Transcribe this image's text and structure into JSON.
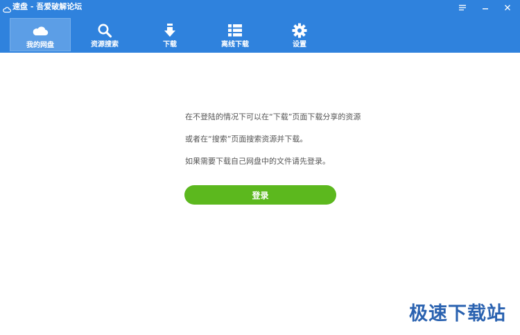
{
  "window": {
    "title": "速盘 - 吾爱破解论坛",
    "icons": {
      "logo": "cloud-icon",
      "menu": "menu-icon",
      "minimize": "minimize-icon",
      "close": "close-icon"
    }
  },
  "toolbar": {
    "items": [
      {
        "label": "我的网盘",
        "icon": "cloud-icon",
        "active": true
      },
      {
        "label": "资源搜索",
        "icon": "search-icon",
        "active": false
      },
      {
        "label": "下载",
        "icon": "download-arrow-icon",
        "active": false
      },
      {
        "label": "离线下载",
        "icon": "list-icon",
        "active": false
      },
      {
        "label": "设置",
        "icon": "gear-icon",
        "active": false
      }
    ]
  },
  "main": {
    "messages": [
      "在不登陆的情况下可以在“下载”页面下载分享的资源",
      "或者在“搜索”页面搜索资源并下载。",
      "如果需要下载自己网盘中的文件请先登录。"
    ],
    "login_label": "登录"
  },
  "watermark": "极速下载站",
  "colors": {
    "header_bg": "#2f82dd",
    "active_tab_bg": "#5c9ee6",
    "login_button": "#5cb81e",
    "watermark": "#2a62b0"
  }
}
